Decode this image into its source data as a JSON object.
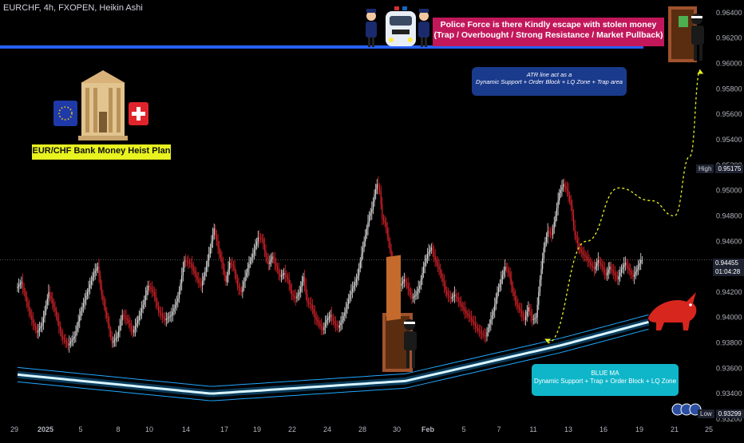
{
  "header": {
    "symbol_line": "EURCHF, 4h, FXOPEN, Heikin Ashi"
  },
  "annotations": {
    "police_line1": "Police Force is there Kindly escape with stolen money",
    "police_line2": "(Trap / Overbought / Strong Resistance / Market Pullback)",
    "atr_line1": "ATR line act as a",
    "atr_line2": "Dynamic Support + Order Block + LQ Zone + Trap area",
    "ma_line1": "BLUE MA",
    "ma_line2": "Dynamic Support + Trap + Order Block + LQ Zone",
    "heist_label": "EUR/CHF Bank Money Heist Plan"
  },
  "price_tags": {
    "high_label": "High",
    "high_value": "0.95175",
    "low_label": "Low",
    "low_value": "0.93299",
    "last_value": "0.94455",
    "countdown": "01:04:28"
  },
  "colors": {
    "up": "#e6e6e6",
    "down": "#e0242b",
    "resistance": "#2962ff",
    "ma": "#1ea7ff",
    "projection": "#e8f31f",
    "police_box": "#c2185b",
    "atr_box": "#1a3a8c",
    "ma_box": "#0fb6c9",
    "heist_box": "#e8f31f"
  },
  "icons": [
    "police-officers-icon",
    "police-car-icon",
    "bank-building-icon",
    "eu-flag-icon",
    "swiss-flag-icon",
    "thief-in-door-icon",
    "bull-icon",
    "tradingview-logo-icon"
  ],
  "chart_data": {
    "type": "candlestick",
    "title": "",
    "x_ticks": [
      "29",
      "2025",
      "5",
      "8",
      "10",
      "14",
      "17",
      "19",
      "22",
      "24",
      "28",
      "30",
      "Feb",
      "5",
      "7",
      "11",
      "13",
      "16",
      "19",
      "21",
      "25"
    ],
    "y_ticks": [
      "0.96400",
      "0.96200",
      "0.96000",
      "0.95800",
      "0.95600",
      "0.95400",
      "0.95200",
      "0.95000",
      "0.94800",
      "0.94600",
      "0.94400",
      "0.94200",
      "0.94000",
      "0.93800",
      "0.93600",
      "0.93400",
      "0.93200"
    ],
    "ylim": [
      0.932,
      0.965
    ],
    "resistance_level": 0.9613,
    "session_high": 0.95175,
    "session_low": 0.93299,
    "last_price": 0.94455,
    "close_path": [
      [
        0,
        0.9423
      ],
      [
        4,
        0.9428
      ],
      [
        8,
        0.9412
      ],
      [
        12,
        0.9398
      ],
      [
        16,
        0.9388
      ],
      [
        20,
        0.9395
      ],
      [
        25,
        0.942
      ],
      [
        30,
        0.9405
      ],
      [
        35,
        0.9385
      ],
      [
        40,
        0.9378
      ],
      [
        45,
        0.9385
      ],
      [
        50,
        0.9405
      ],
      [
        55,
        0.942
      ],
      [
        60,
        0.9435
      ],
      [
        63,
        0.944
      ],
      [
        66,
        0.9418
      ],
      [
        70,
        0.94
      ],
      [
        74,
        0.938
      ],
      [
        78,
        0.9385
      ],
      [
        82,
        0.9402
      ],
      [
        86,
        0.9398
      ],
      [
        90,
        0.9388
      ],
      [
        94,
        0.9398
      ],
      [
        98,
        0.941
      ],
      [
        102,
        0.9425
      ],
      [
        106,
        0.942
      ],
      [
        110,
        0.9405
      ],
      [
        115,
        0.9398
      ],
      [
        120,
        0.9402
      ],
      [
        125,
        0.9415
      ],
      [
        130,
        0.9445
      ],
      [
        135,
        0.9442
      ],
      [
        140,
        0.943
      ],
      [
        143,
        0.9425
      ],
      [
        147,
        0.944
      ],
      [
        150,
        0.9455
      ],
      [
        153,
        0.947
      ],
      [
        156,
        0.9455
      ],
      [
        159,
        0.9443
      ],
      [
        162,
        0.9428
      ],
      [
        165,
        0.9443
      ],
      [
        168,
        0.944
      ],
      [
        171,
        0.9425
      ],
      [
        174,
        0.942
      ],
      [
        177,
        0.9432
      ],
      [
        180,
        0.9442
      ],
      [
        183,
        0.945
      ],
      [
        187,
        0.9463
      ],
      [
        190,
        0.9462
      ],
      [
        193,
        0.9448
      ],
      [
        195,
        0.9442
      ],
      [
        198,
        0.9448
      ],
      [
        201,
        0.944
      ],
      [
        204,
        0.9432
      ],
      [
        207,
        0.9435
      ],
      [
        210,
        0.943
      ],
      [
        213,
        0.9418
      ],
      [
        216,
        0.9415
      ],
      [
        219,
        0.942
      ],
      [
        222,
        0.9432
      ],
      [
        225,
        0.9412
      ],
      [
        228,
        0.941
      ],
      [
        231,
        0.94
      ],
      [
        234,
        0.9395
      ],
      [
        237,
        0.939
      ],
      [
        240,
        0.9398
      ],
      [
        243,
        0.9402
      ],
      [
        246,
        0.9395
      ],
      [
        249,
        0.9392
      ],
      [
        252,
        0.9398
      ],
      [
        255,
        0.9407
      ],
      [
        258,
        0.9418
      ],
      [
        261,
        0.9425
      ],
      [
        264,
        0.9433
      ],
      [
        267,
        0.945
      ],
      [
        269,
        0.946
      ],
      [
        271,
        0.947
      ],
      [
        273,
        0.948
      ],
      [
        275,
        0.9485
      ],
      [
        277,
        0.9497
      ],
      [
        279,
        0.9505
      ],
      [
        281,
        0.95
      ],
      [
        283,
        0.9478
      ],
      [
        285,
        0.9475
      ],
      [
        288,
        0.946
      ],
      [
        291,
        0.944
      ],
      [
        294,
        0.9432
      ],
      [
        297,
        0.9425
      ],
      [
        300,
        0.943
      ],
      [
        303,
        0.9423
      ],
      [
        306,
        0.9415
      ],
      [
        309,
        0.9418
      ],
      [
        312,
        0.9425
      ],
      [
        315,
        0.944
      ],
      [
        318,
        0.945
      ],
      [
        321,
        0.9455
      ],
      [
        324,
        0.9445
      ],
      [
        327,
        0.9438
      ],
      [
        330,
        0.9428
      ],
      [
        333,
        0.9418
      ],
      [
        336,
        0.9415
      ],
      [
        339,
        0.9418
      ],
      [
        342,
        0.9413
      ],
      [
        345,
        0.9408
      ],
      [
        348,
        0.9403
      ],
      [
        351,
        0.94
      ],
      [
        354,
        0.9395
      ],
      [
        357,
        0.939
      ],
      [
        360,
        0.9387
      ],
      [
        363,
        0.9385
      ],
      [
        366,
        0.9395
      ],
      [
        369,
        0.9405
      ],
      [
        372,
        0.942
      ],
      [
        375,
        0.943
      ],
      [
        378,
        0.944
      ],
      [
        381,
        0.9435
      ],
      [
        384,
        0.942
      ],
      [
        387,
        0.941
      ],
      [
        390,
        0.9405
      ],
      [
        393,
        0.9398
      ],
      [
        396,
        0.9408
      ],
      [
        399,
        0.9398
      ],
      [
        402,
        0.94
      ],
      [
        405,
        0.943
      ],
      [
        408,
        0.9455
      ],
      [
        411,
        0.9468
      ],
      [
        414,
        0.9465
      ],
      [
        417,
        0.948
      ],
      [
        420,
        0.9498
      ],
      [
        423,
        0.9505
      ],
      [
        426,
        0.95
      ],
      [
        429,
        0.9488
      ],
      [
        432,
        0.9465
      ],
      [
        435,
        0.9455
      ],
      [
        438,
        0.945
      ],
      [
        441,
        0.9447
      ],
      [
        444,
        0.9442
      ],
      [
        447,
        0.9438
      ],
      [
        450,
        0.9445
      ],
      [
        453,
        0.944
      ],
      [
        456,
        0.9433
      ],
      [
        459,
        0.944
      ],
      [
        462,
        0.9435
      ],
      [
        465,
        0.943
      ],
      [
        468,
        0.9438
      ],
      [
        471,
        0.9443
      ],
      [
        474,
        0.9437
      ],
      [
        477,
        0.9432
      ],
      [
        480,
        0.9438
      ],
      [
        483,
        0.9445
      ]
    ],
    "blue_ma": [
      [
        0,
        0.9355
      ],
      [
        150,
        0.934
      ],
      [
        300,
        0.935
      ],
      [
        420,
        0.9378
      ],
      [
        490,
        0.9397
      ]
    ],
    "projection_path": [
      [
        410,
        0.938
      ],
      [
        440,
        0.946
      ],
      [
        465,
        0.9502
      ],
      [
        490,
        0.9492
      ],
      [
        508,
        0.948
      ],
      [
        520,
        0.9527
      ],
      [
        528,
        0.9595
      ]
    ]
  }
}
